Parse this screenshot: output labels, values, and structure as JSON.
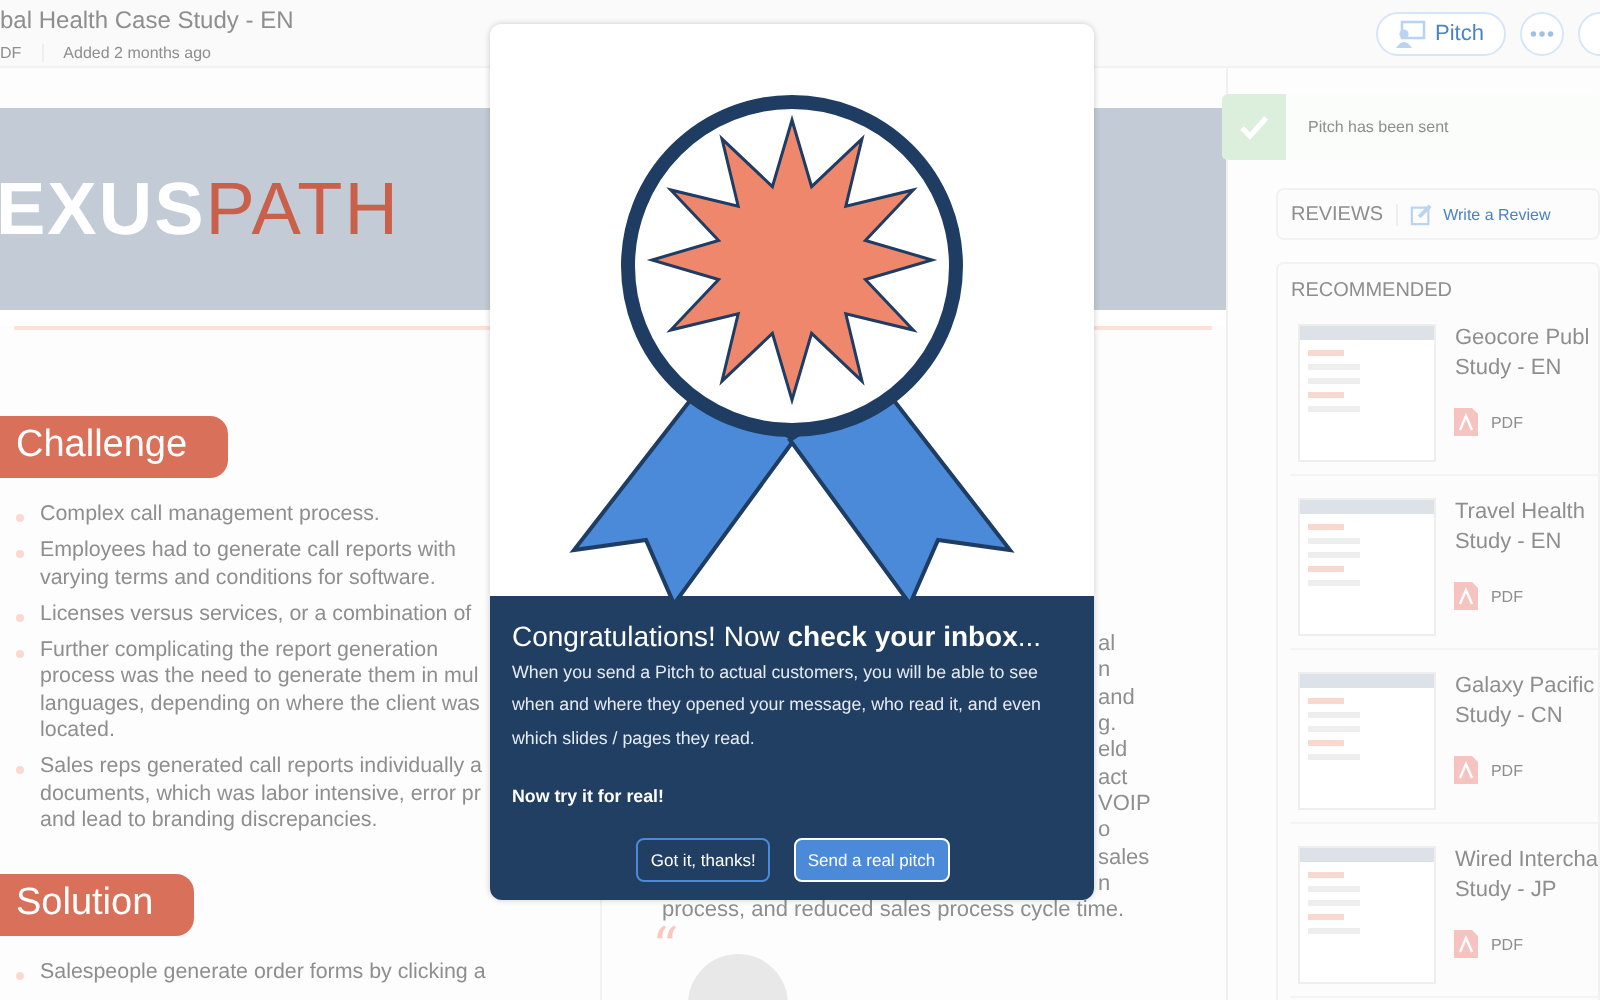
{
  "header": {
    "title": "bal Health Case Study - EN",
    "file_type": "DF",
    "added": "Added 2 months ago",
    "pitch_button": "Pitch"
  },
  "banner": {
    "logo_left": "EXUS",
    "logo_right": "PATH"
  },
  "toast": {
    "message": "Pitch has been sent"
  },
  "sections": [
    {
      "heading": "Challenge",
      "bullets": [
        [
          "Complex call management process."
        ],
        [
          "Employees had to generate call reports with",
          "varying terms and conditions for software."
        ],
        [
          "Licenses versus services, or a combination of"
        ],
        [
          "Further complicating the report generation",
          "process was the need to generate them in mul",
          "languages, depending on where the client was",
          "located."
        ],
        [
          "Sales reps generated call reports individually a",
          "documents, which was labor intensive, error pr",
          "and lead to branding discrepancies."
        ]
      ]
    },
    {
      "heading": "Solution",
      "bullets": [
        [
          "Salespeople generate order forms by clicking a"
        ]
      ]
    }
  ],
  "middle": {
    "fragments": [
      "al",
      "n",
      "and",
      "g.",
      "eld",
      "act",
      "VOIP",
      "o",
      "sales",
      "n"
    ],
    "line": "process, and reduced sales process cycle time.",
    "quote_mark": "“"
  },
  "reviews": {
    "heading": "REVIEWS",
    "link": "Write a Review"
  },
  "recommended": {
    "heading": "RECOMMENDED",
    "items": [
      {
        "title_lines": [
          "Geocore Publ",
          "Study - EN"
        ],
        "file_type": "PDF"
      },
      {
        "title_lines": [
          "Travel Health",
          "Study - EN"
        ],
        "file_type": "PDF"
      },
      {
        "title_lines": [
          "Galaxy Pacific",
          "Study - CN"
        ],
        "file_type": "PDF"
      },
      {
        "title_lines": [
          "Wired Intercha",
          "Study - JP"
        ],
        "file_type": "PDF"
      }
    ]
  },
  "modal": {
    "title": "Congratulations! Now **check your inbox**...",
    "body": "When you send a Pitch to actual customers, you will be able to see when and where they opened your message, who read it, and even which slides / pages they read.",
    "cta": "Now try it for real!",
    "buttons": [
      {
        "label": "Got it, thanks!",
        "kind": "secondary"
      },
      {
        "label": "Send a real pitch",
        "kind": "primary"
      }
    ]
  }
}
